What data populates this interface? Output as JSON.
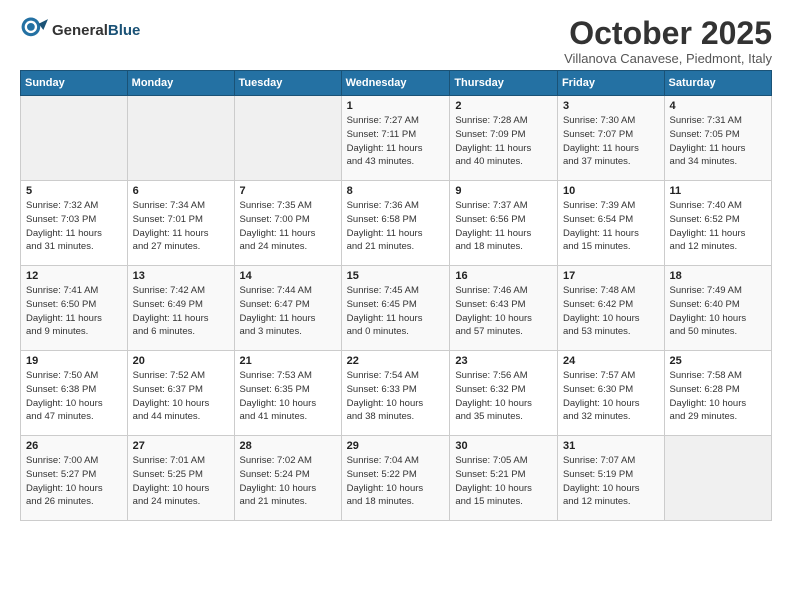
{
  "logo": {
    "general": "General",
    "blue": "Blue"
  },
  "header": {
    "month": "October 2025",
    "location": "Villanova Canavese, Piedmont, Italy"
  },
  "weekdays": [
    "Sunday",
    "Monday",
    "Tuesday",
    "Wednesday",
    "Thursday",
    "Friday",
    "Saturday"
  ],
  "weeks": [
    [
      {
        "day": "",
        "info": ""
      },
      {
        "day": "",
        "info": ""
      },
      {
        "day": "",
        "info": ""
      },
      {
        "day": "1",
        "info": "Sunrise: 7:27 AM\nSunset: 7:11 PM\nDaylight: 11 hours\nand 43 minutes."
      },
      {
        "day": "2",
        "info": "Sunrise: 7:28 AM\nSunset: 7:09 PM\nDaylight: 11 hours\nand 40 minutes."
      },
      {
        "day": "3",
        "info": "Sunrise: 7:30 AM\nSunset: 7:07 PM\nDaylight: 11 hours\nand 37 minutes."
      },
      {
        "day": "4",
        "info": "Sunrise: 7:31 AM\nSunset: 7:05 PM\nDaylight: 11 hours\nand 34 minutes."
      }
    ],
    [
      {
        "day": "5",
        "info": "Sunrise: 7:32 AM\nSunset: 7:03 PM\nDaylight: 11 hours\nand 31 minutes."
      },
      {
        "day": "6",
        "info": "Sunrise: 7:34 AM\nSunset: 7:01 PM\nDaylight: 11 hours\nand 27 minutes."
      },
      {
        "day": "7",
        "info": "Sunrise: 7:35 AM\nSunset: 7:00 PM\nDaylight: 11 hours\nand 24 minutes."
      },
      {
        "day": "8",
        "info": "Sunrise: 7:36 AM\nSunset: 6:58 PM\nDaylight: 11 hours\nand 21 minutes."
      },
      {
        "day": "9",
        "info": "Sunrise: 7:37 AM\nSunset: 6:56 PM\nDaylight: 11 hours\nand 18 minutes."
      },
      {
        "day": "10",
        "info": "Sunrise: 7:39 AM\nSunset: 6:54 PM\nDaylight: 11 hours\nand 15 minutes."
      },
      {
        "day": "11",
        "info": "Sunrise: 7:40 AM\nSunset: 6:52 PM\nDaylight: 11 hours\nand 12 minutes."
      }
    ],
    [
      {
        "day": "12",
        "info": "Sunrise: 7:41 AM\nSunset: 6:50 PM\nDaylight: 11 hours\nand 9 minutes."
      },
      {
        "day": "13",
        "info": "Sunrise: 7:42 AM\nSunset: 6:49 PM\nDaylight: 11 hours\nand 6 minutes."
      },
      {
        "day": "14",
        "info": "Sunrise: 7:44 AM\nSunset: 6:47 PM\nDaylight: 11 hours\nand 3 minutes."
      },
      {
        "day": "15",
        "info": "Sunrise: 7:45 AM\nSunset: 6:45 PM\nDaylight: 11 hours\nand 0 minutes."
      },
      {
        "day": "16",
        "info": "Sunrise: 7:46 AM\nSunset: 6:43 PM\nDaylight: 10 hours\nand 57 minutes."
      },
      {
        "day": "17",
        "info": "Sunrise: 7:48 AM\nSunset: 6:42 PM\nDaylight: 10 hours\nand 53 minutes."
      },
      {
        "day": "18",
        "info": "Sunrise: 7:49 AM\nSunset: 6:40 PM\nDaylight: 10 hours\nand 50 minutes."
      }
    ],
    [
      {
        "day": "19",
        "info": "Sunrise: 7:50 AM\nSunset: 6:38 PM\nDaylight: 10 hours\nand 47 minutes."
      },
      {
        "day": "20",
        "info": "Sunrise: 7:52 AM\nSunset: 6:37 PM\nDaylight: 10 hours\nand 44 minutes."
      },
      {
        "day": "21",
        "info": "Sunrise: 7:53 AM\nSunset: 6:35 PM\nDaylight: 10 hours\nand 41 minutes."
      },
      {
        "day": "22",
        "info": "Sunrise: 7:54 AM\nSunset: 6:33 PM\nDaylight: 10 hours\nand 38 minutes."
      },
      {
        "day": "23",
        "info": "Sunrise: 7:56 AM\nSunset: 6:32 PM\nDaylight: 10 hours\nand 35 minutes."
      },
      {
        "day": "24",
        "info": "Sunrise: 7:57 AM\nSunset: 6:30 PM\nDaylight: 10 hours\nand 32 minutes."
      },
      {
        "day": "25",
        "info": "Sunrise: 7:58 AM\nSunset: 6:28 PM\nDaylight: 10 hours\nand 29 minutes."
      }
    ],
    [
      {
        "day": "26",
        "info": "Sunrise: 7:00 AM\nSunset: 5:27 PM\nDaylight: 10 hours\nand 26 minutes."
      },
      {
        "day": "27",
        "info": "Sunrise: 7:01 AM\nSunset: 5:25 PM\nDaylight: 10 hours\nand 24 minutes."
      },
      {
        "day": "28",
        "info": "Sunrise: 7:02 AM\nSunset: 5:24 PM\nDaylight: 10 hours\nand 21 minutes."
      },
      {
        "day": "29",
        "info": "Sunrise: 7:04 AM\nSunset: 5:22 PM\nDaylight: 10 hours\nand 18 minutes."
      },
      {
        "day": "30",
        "info": "Sunrise: 7:05 AM\nSunset: 5:21 PM\nDaylight: 10 hours\nand 15 minutes."
      },
      {
        "day": "31",
        "info": "Sunrise: 7:07 AM\nSunset: 5:19 PM\nDaylight: 10 hours\nand 12 minutes."
      },
      {
        "day": "",
        "info": ""
      }
    ]
  ]
}
